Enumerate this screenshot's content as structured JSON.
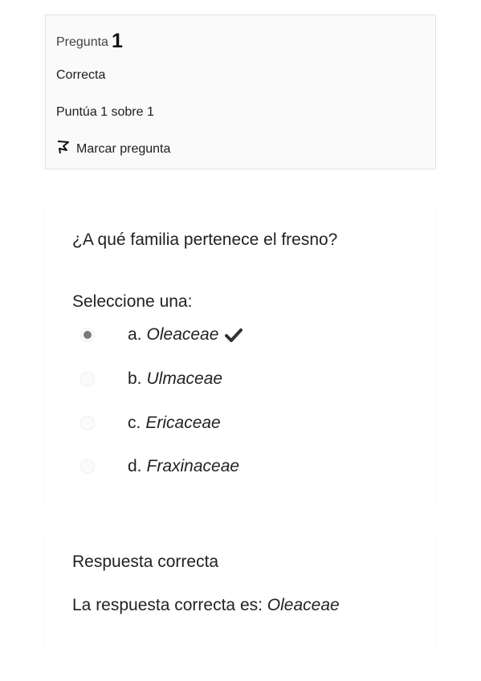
{
  "info": {
    "question_label": "Pregunta",
    "question_number": "1",
    "state": "Correcta",
    "grade": "Puntúa 1 sobre 1",
    "flag_label": "Marcar pregunta"
  },
  "question": {
    "text": "¿A qué familia pertenece el fresno?",
    "prompt": "Seleccione una:",
    "answers": [
      {
        "letter": "a.",
        "text": "Oleaceae",
        "selected": true,
        "correct": true
      },
      {
        "letter": "b.",
        "text": "Ulmaceae",
        "selected": false
      },
      {
        "letter": "c.",
        "text": "Ericaceae",
        "selected": false
      },
      {
        "letter": "d.",
        "text": "Fraxinaceae",
        "selected": false
      }
    ]
  },
  "feedback": {
    "result": "Respuesta correcta",
    "right_answer_prefix": "La respuesta correcta es: ",
    "right_answer": "Oleaceae"
  },
  "icons": {
    "flag": "flag-icon",
    "check": "checkmark-icon"
  }
}
